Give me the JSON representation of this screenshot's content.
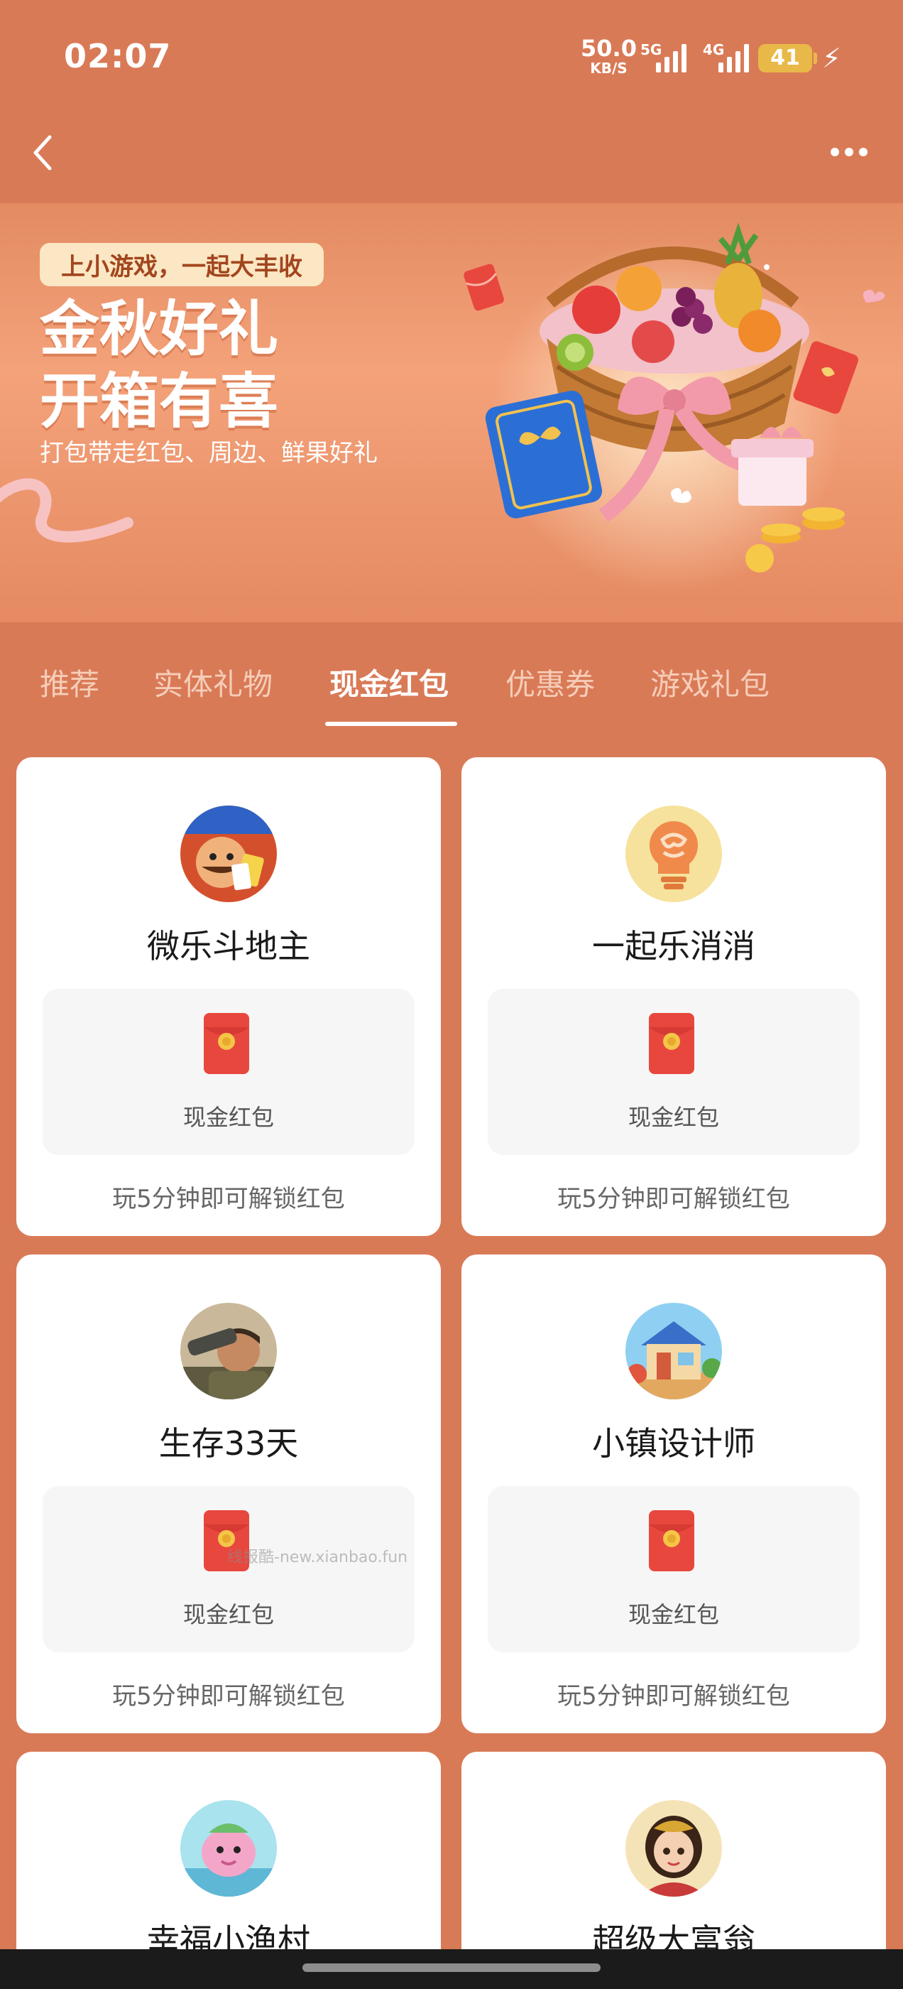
{
  "status_bar": {
    "time": "02:07",
    "net_speed": "50.0",
    "net_speed_unit": "KB/S",
    "signal_1_label": "5G",
    "signal_2_label": "4G",
    "battery": "41"
  },
  "banner": {
    "tagline": "上小游戏，一起大丰收",
    "headline_line1": "金秋好礼",
    "headline_line2": "开箱有喜",
    "subline": "打包带走红包、周边、鲜果好礼"
  },
  "tabs": [
    {
      "label": "推荐"
    },
    {
      "label": "实体礼物"
    },
    {
      "label": "现金红包",
      "active": true
    },
    {
      "label": "优惠券"
    },
    {
      "label": "游戏礼包"
    }
  ],
  "cards": [
    {
      "name": "微乐斗地主",
      "reward": "现金红包",
      "hint": "玩5分钟即可解锁红包",
      "icon": "doudizhu-avatar-icon"
    },
    {
      "name": "一起乐消消",
      "reward": "现金红包",
      "hint": "玩5分钟即可解锁红包",
      "icon": "lightbulb-brain-icon"
    },
    {
      "name": "生存33天",
      "reward": "现金红包",
      "hint": "玩5分钟即可解锁红包",
      "icon": "soldier-avatar-icon"
    },
    {
      "name": "小镇设计师",
      "reward": "现金红包",
      "hint": "玩5分钟即可解锁红包",
      "icon": "house-avatar-icon"
    },
    {
      "name": "幸福小渔村",
      "icon": "pink-fish-avatar-icon"
    },
    {
      "name": "超级大富翁",
      "icon": "girl-avatar-icon"
    }
  ],
  "watermark": "线报酷-new.xianbao.fun",
  "colors": {
    "background": "#d97a57",
    "card": "#ffffff",
    "envelope": "#e8473e",
    "battery": "#e8b948"
  }
}
